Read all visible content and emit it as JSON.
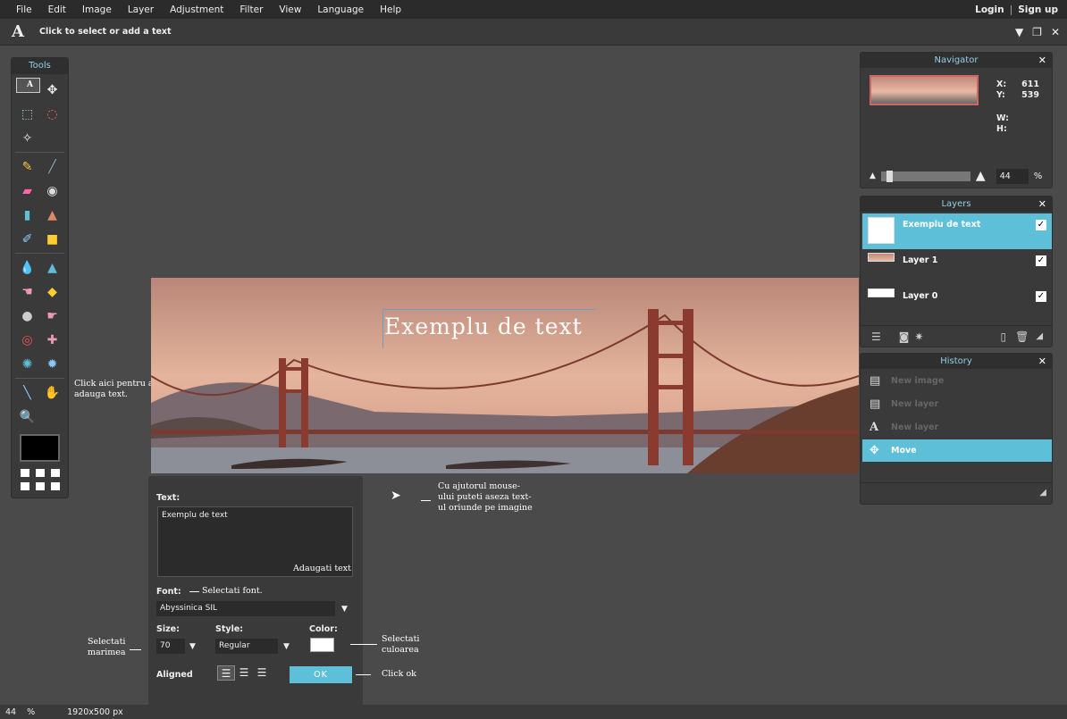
{
  "menubar": {
    "items": [
      "File",
      "Edit",
      "Image",
      "Layer",
      "Adjustment",
      "Filter",
      "View",
      "Language",
      "Help"
    ],
    "login": "Login",
    "separator": "|",
    "signup": "Sign up"
  },
  "optionbar": {
    "tool_glyph": "A",
    "hint": "Click to select or add a text"
  },
  "tools": {
    "title": "Tools"
  },
  "canvas": {
    "text": "Exemplu de text"
  },
  "navigator": {
    "title": "Navigator",
    "x_label": "X:",
    "x_value": "611",
    "y_label": "Y:",
    "y_value": "539",
    "w_label": "W:",
    "h_label": "H:",
    "zoom": "44",
    "zoom_unit": "%"
  },
  "layers": {
    "title": "Layers",
    "items": [
      {
        "name": "Exemplu de text"
      },
      {
        "name": "Layer 1"
      },
      {
        "name": "Layer 0"
      }
    ]
  },
  "history": {
    "title": "History",
    "items": [
      "New image",
      "New layer",
      "New layer",
      "Move"
    ]
  },
  "text_dialog": {
    "text_label": "Text:",
    "text_value": "Exemplu de text",
    "font_label": "Font:",
    "font_value": "Abyssinica SIL",
    "size_label": "Size:",
    "size_value": "70",
    "style_label": "Style:",
    "style_value": "Regular",
    "color_label": "Color:",
    "aligned_label": "Aligned",
    "ok_label": "OK"
  },
  "annotations": {
    "click_text_tool": "Click aici pentru a adauga text.",
    "move_text": "Cu ajutorul mouse-ului puteti aseza text-ul oriunde pe imagine",
    "add_text": "Adaugati text",
    "select_font": "Selectati font.",
    "select_size": "Selectati marimea",
    "select_color": "Selectati culoarea",
    "click_ok": "Click ok"
  },
  "status": {
    "zoom": "44",
    "unit": "%",
    "dimensions": "1920x500 px"
  },
  "colors": {
    "accent": "#5ec0d8",
    "panel_bg": "#3a3a3a",
    "workspace_bg": "#4a4a4a",
    "foreground_color": "#000000",
    "text_color": "#ffffff"
  }
}
